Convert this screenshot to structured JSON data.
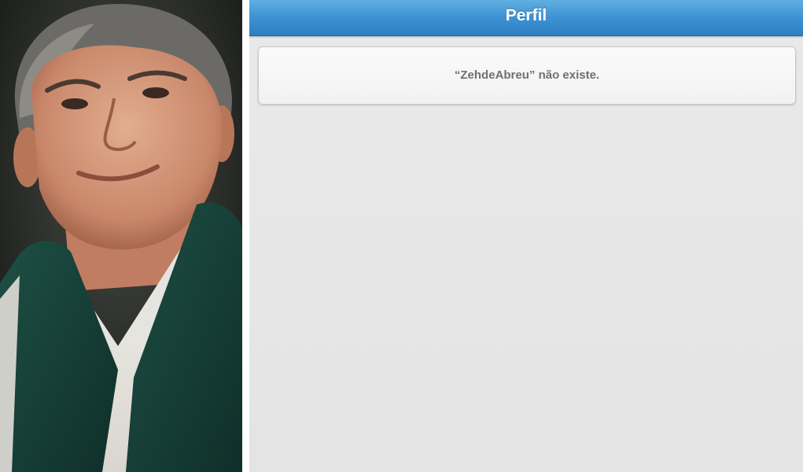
{
  "navbar": {
    "title": "Perfil"
  },
  "message": {
    "text": "“ZehdeAbreu” não existe."
  },
  "photo": {
    "subject": "portrait-photo"
  },
  "colors": {
    "navbar_top": "#62aee3",
    "navbar_bottom": "#2d7fc2",
    "background": "#e6e6e6",
    "card": "#f5f5f5",
    "message_text": "#707070"
  }
}
